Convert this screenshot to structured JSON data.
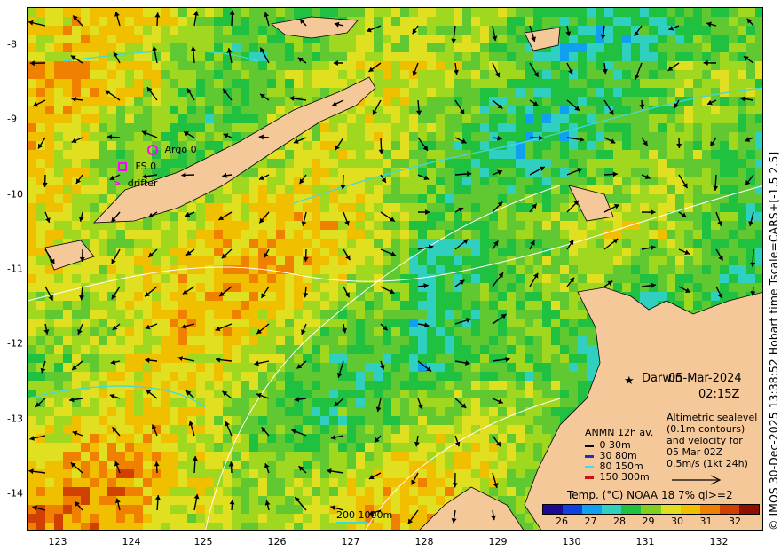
{
  "map": {
    "lon_ticks": [
      "123",
      "124",
      "125",
      "126",
      "127",
      "128",
      "129",
      "130",
      "131",
      "132"
    ],
    "lat_ticks": [
      "-8",
      "-9",
      "-10",
      "-11",
      "-12",
      "-13",
      "-14"
    ],
    "date": "05-Mar-2024",
    "time": "02:15Z",
    "place_label": "Darwin",
    "credit": "© IMOS 30-Dec-2025 13:38:52 Hobart time Tscale=CARS+[-1.5 2.5]"
  },
  "obs_legend": {
    "argo": "Argo 0",
    "fs": "FS 0",
    "drifter": "drifter",
    "colors": {
      "marker": "#ff00ff"
    }
  },
  "anmn": {
    "title": "ANMN 12h av.",
    "items": [
      {
        "label": "0 30m",
        "color": "#000000"
      },
      {
        "label": "30 80m",
        "color": "#1a2fd0"
      },
      {
        "label": "80 150m",
        "color": "#30e0ff"
      },
      {
        "label": "150 300m",
        "color": "#d01010"
      }
    ]
  },
  "altimetry": {
    "line1": "Altimetric sealevel",
    "line2": "(0.1m contours)",
    "line3": "and velocity for",
    "line4": "05 Mar 02Z",
    "line5": "0.5m/s (1kt 24h)"
  },
  "depth": {
    "label": "200  1000m",
    "color": "#40d8e0"
  },
  "colorbar": {
    "title": "Temp. (°C) NOAA 18 7% ql>=2",
    "ticks": [
      "26",
      "27",
      "28",
      "29",
      "30",
      "31",
      "32"
    ],
    "colors": [
      "#1a0a90",
      "#1040e0",
      "#10a0f0",
      "#30d0c0",
      "#20c040",
      "#80d020",
      "#e0e020",
      "#f0c000",
      "#f08000",
      "#d04000",
      "#901000"
    ]
  },
  "land_color": "#f5c89a"
}
